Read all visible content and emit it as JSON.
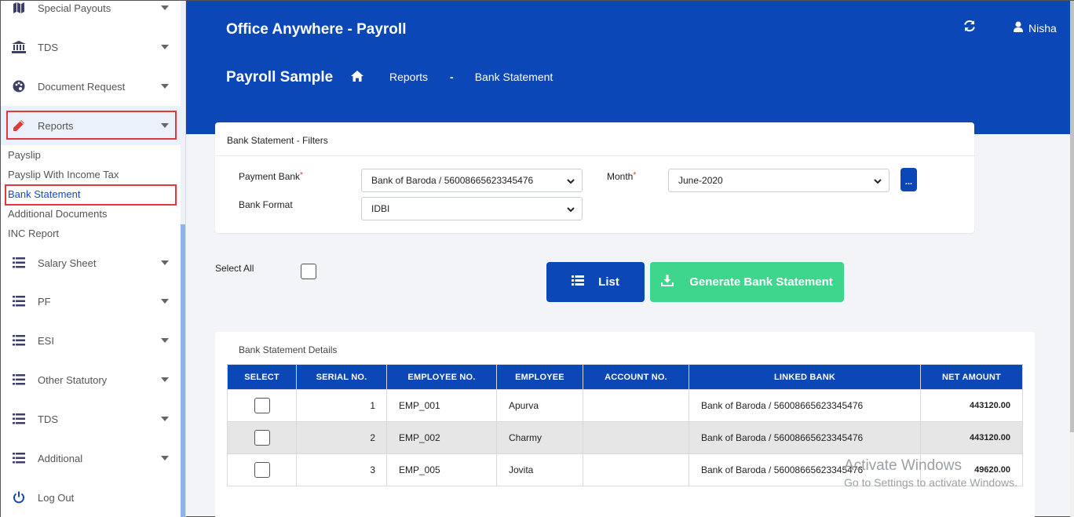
{
  "sidebar": {
    "items": [
      {
        "label": "Special Payouts",
        "icon": "map-icon"
      },
      {
        "label": "TDS",
        "icon": "bank-icon"
      },
      {
        "label": "Document Request",
        "icon": "palette-icon"
      },
      {
        "label": "Reports",
        "icon": "pencil-icon"
      },
      {
        "label": "Salary Sheet",
        "icon": "list-icon"
      },
      {
        "label": "PF",
        "icon": "list-icon"
      },
      {
        "label": "ESI",
        "icon": "list-icon"
      },
      {
        "label": "Other Statutory",
        "icon": "list-icon"
      },
      {
        "label": "TDS",
        "icon": "list-icon"
      },
      {
        "label": "Additional",
        "icon": "list-icon"
      },
      {
        "label": "Log Out",
        "icon": "power-icon"
      }
    ],
    "report_sub_items": [
      "Payslip",
      "Payslip With Income Tax",
      "Bank Statement",
      "Additional Documents",
      "INC Report"
    ]
  },
  "header": {
    "app_title": "Office Anywhere - Payroll",
    "user_name": "Nisha",
    "page_title": "Payroll Sample",
    "breadcrumb": {
      "link": "Reports",
      "separator": "-",
      "current": "Bank Statement"
    }
  },
  "filters": {
    "title": "Bank Statement - Filters",
    "payment_bank_label": "Payment Bank",
    "payment_bank_value": "Bank of Baroda / 56008665623345476",
    "month_label": "Month",
    "month_value": "June-2020",
    "bank_format_label": "Bank Format",
    "bank_format_value": "IDBI",
    "required_mark": "*",
    "more_button": "..."
  },
  "actions": {
    "select_all_label": "Select All",
    "list_label": "List",
    "generate_label": "Generate Bank Statement"
  },
  "details": {
    "title": "Bank Statement Details",
    "columns": [
      "SELECT",
      "SERIAL NO.",
      "EMPLOYEE NO.",
      "EMPLOYEE",
      "ACCOUNT NO.",
      "LINKED BANK",
      "NET AMOUNT"
    ],
    "rows": [
      {
        "serial": "1",
        "emp_no": "EMP_001",
        "employee": "Apurva",
        "account": "",
        "bank": "Bank of Baroda / 56008665623345476",
        "amount": "443120.00"
      },
      {
        "serial": "2",
        "emp_no": "EMP_002",
        "employee": "Charmy",
        "account": "",
        "bank": "Bank of Baroda / 56008665623345476",
        "amount": "443120.00"
      },
      {
        "serial": "3",
        "emp_no": "EMP_005",
        "employee": "Jovita",
        "account": "",
        "bank": "Bank of Baroda / 56008665623345476",
        "amount": "49620.00"
      }
    ]
  },
  "watermark": {
    "line1": "Activate Windows",
    "line2": "Go to Settings to activate Windows."
  },
  "colors": {
    "primary": "#0c47b7",
    "success": "#3dd68c",
    "highlight": "#e03b3b",
    "active_link": "#1a47c7"
  }
}
